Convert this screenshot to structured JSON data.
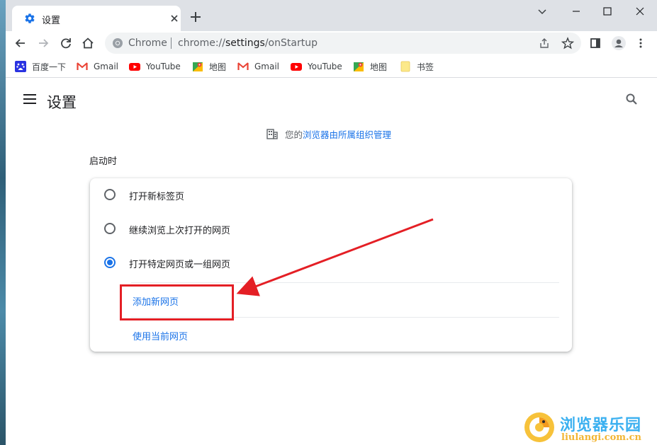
{
  "tab": {
    "title": "设置"
  },
  "omnibox": {
    "site_label": "Chrome",
    "url_prefix": "chrome://",
    "url_path": "settings",
    "url_suffix": "/onStartup"
  },
  "bookmarks": [
    {
      "label": "百度一下",
      "icon": "baidu-icon"
    },
    {
      "label": "Gmail",
      "icon": "gmail-icon"
    },
    {
      "label": "YouTube",
      "icon": "youtube-icon"
    },
    {
      "label": "地图",
      "icon": "maps-icon"
    },
    {
      "label": "Gmail",
      "icon": "gmail-icon"
    },
    {
      "label": "YouTube",
      "icon": "youtube-icon"
    },
    {
      "label": "地图",
      "icon": "maps-icon"
    },
    {
      "label": "书签",
      "icon": "folder-icon"
    }
  ],
  "page": {
    "title": "设置",
    "managed_prefix": "您的",
    "managed_link": "浏览器由所属组织管理",
    "section_title": "启动时",
    "options": [
      {
        "label": "打开新标签页",
        "checked": false
      },
      {
        "label": "继续浏览上次打开的网页",
        "checked": false
      },
      {
        "label": "打开特定网页或一组网页",
        "checked": true
      }
    ],
    "add_page_link": "添加新网页",
    "use_current_link": "使用当前网页"
  },
  "colors": {
    "accent": "#1a73e8",
    "annotation": "#e41f25",
    "tabstrip": "#dee1e6"
  },
  "watermark": {
    "title": "浏览器乐园",
    "url": "liulangi.com.cn"
  }
}
